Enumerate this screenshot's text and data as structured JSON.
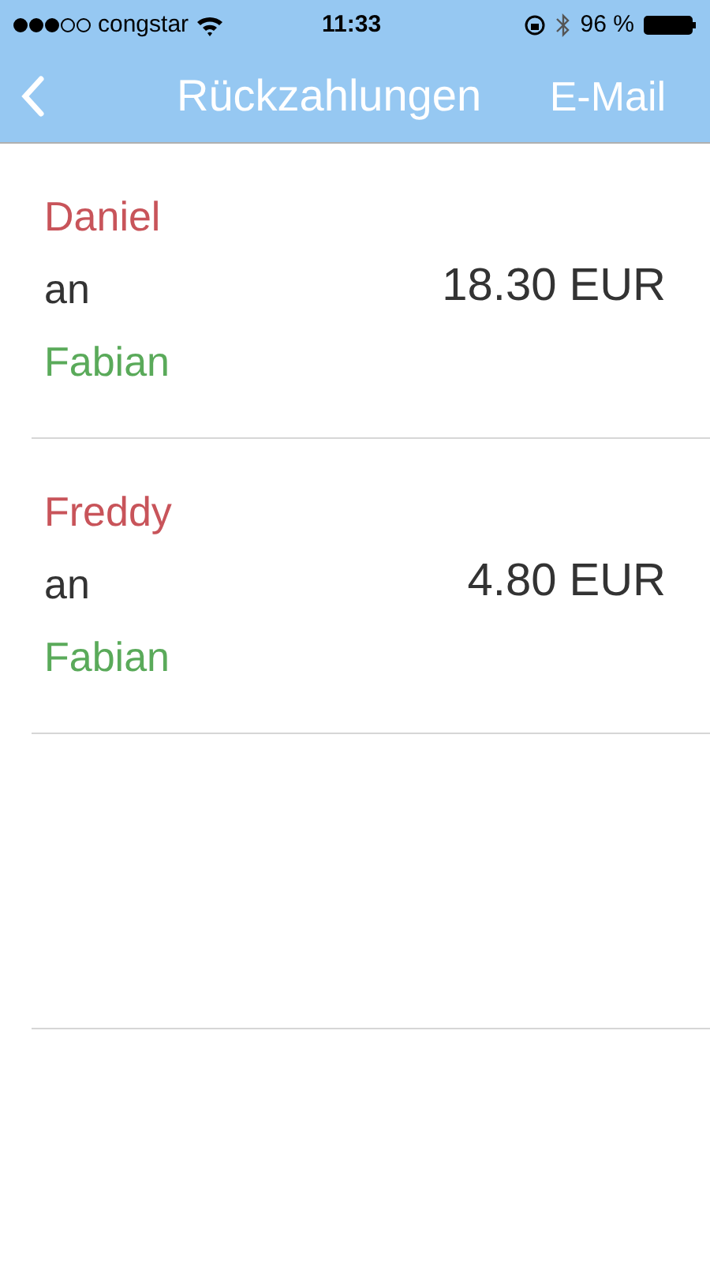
{
  "status_bar": {
    "carrier": "congstar",
    "time": "11:33",
    "battery": "96 %"
  },
  "nav": {
    "title": "Rückzahlungen",
    "action": "E-Mail"
  },
  "payments": [
    {
      "from": "Daniel",
      "connector": "an",
      "to": "Fabian",
      "amount": "18.30 EUR"
    },
    {
      "from": "Freddy",
      "connector": "an",
      "to": "Fabian",
      "amount": "4.80 EUR"
    }
  ]
}
